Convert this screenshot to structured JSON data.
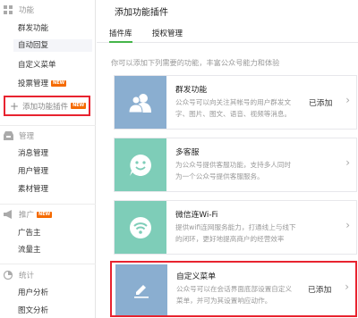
{
  "sidebar": {
    "sections": [
      {
        "label": "功能",
        "icon": "grid-icon"
      },
      {
        "label": "管理",
        "icon": "inbox-icon"
      },
      {
        "label": "推广",
        "icon": "megaphone-icon"
      },
      {
        "label": "统计",
        "icon": "chart-icon"
      }
    ],
    "items": [
      {
        "label": "群发功能"
      },
      {
        "label": "自动回复"
      },
      {
        "label": "自定义菜单"
      },
      {
        "label": "投票管理",
        "badge": "NEW"
      },
      {
        "label": "消息管理"
      },
      {
        "label": "用户管理"
      },
      {
        "label": "素材管理"
      },
      {
        "label": "广告主"
      },
      {
        "label": "流量主"
      },
      {
        "label": "用户分析"
      },
      {
        "label": "图文分析"
      }
    ],
    "promo_badge": "NEW",
    "add_plugin": {
      "label": "添加功能插件",
      "badge": "NEW"
    }
  },
  "main": {
    "title": "添加功能插件",
    "tabs": [
      {
        "label": "插件库",
        "active": true
      },
      {
        "label": "授权管理",
        "active": false
      }
    ],
    "intro": "你可以添加下列需要的功能，丰富公众号能力和体验",
    "plugins": [
      {
        "name": "群发功能",
        "desc": "公众号可以向关注其帐号的用户群发文字、图片、图文、语音、视频等消息。",
        "status": "已添加",
        "icon": "users-icon",
        "color": "#8aaed0"
      },
      {
        "name": "多客服",
        "desc": "为公众号提供客服功能，支持多人同时为一个公众号提供客服服务。",
        "status": "",
        "icon": "chat-smile-icon",
        "color": "#7ecdb8"
      },
      {
        "name": "微信连Wi-Fi",
        "desc": "提供wifi连网服务能力，打通线上与线下的闭环，更好地提高商户的经营效率",
        "status": "",
        "icon": "wifi-icon",
        "color": "#7ecdb8"
      },
      {
        "name": "自定义菜单",
        "desc": "公众号可以在会话界面底部设置自定义菜单，并可为其设置响应动作。",
        "status": "已添加",
        "icon": "edit-icon",
        "color": "#8aaed0"
      }
    ]
  },
  "colors": {
    "accent_green": "#44b549",
    "highlight_red": "#e8232f",
    "badge_orange": "#f56a00"
  }
}
